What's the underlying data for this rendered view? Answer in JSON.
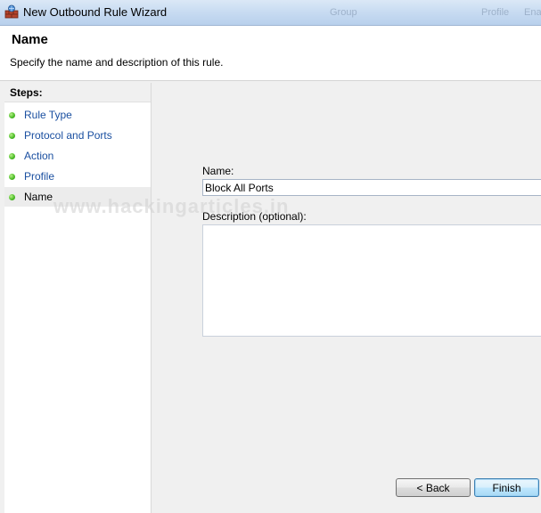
{
  "window": {
    "title": "New Outbound Rule Wizard",
    "background_ghost_labels": [
      "Group",
      "Profile",
      "Enab"
    ]
  },
  "header": {
    "title": "Name",
    "subtitle": "Specify the name and description of this rule."
  },
  "steps": {
    "heading": "Steps:",
    "items": [
      {
        "label": "Rule Type",
        "state": "done"
      },
      {
        "label": "Protocol and Ports",
        "state": "done"
      },
      {
        "label": "Action",
        "state": "done"
      },
      {
        "label": "Profile",
        "state": "done"
      },
      {
        "label": "Name",
        "state": "current"
      }
    ]
  },
  "form": {
    "name_label": "Name:",
    "name_value": "Block All Ports",
    "description_label": "Description (optional):",
    "description_value": ""
  },
  "watermark": "www.hackingarticles.in",
  "buttons": {
    "back_label": "< Back",
    "finish_label": "Finish"
  },
  "colors": {
    "step_link": "#1a4fa0",
    "step_dot": "#4fbf2a",
    "finish_border": "#3c7fb1"
  }
}
